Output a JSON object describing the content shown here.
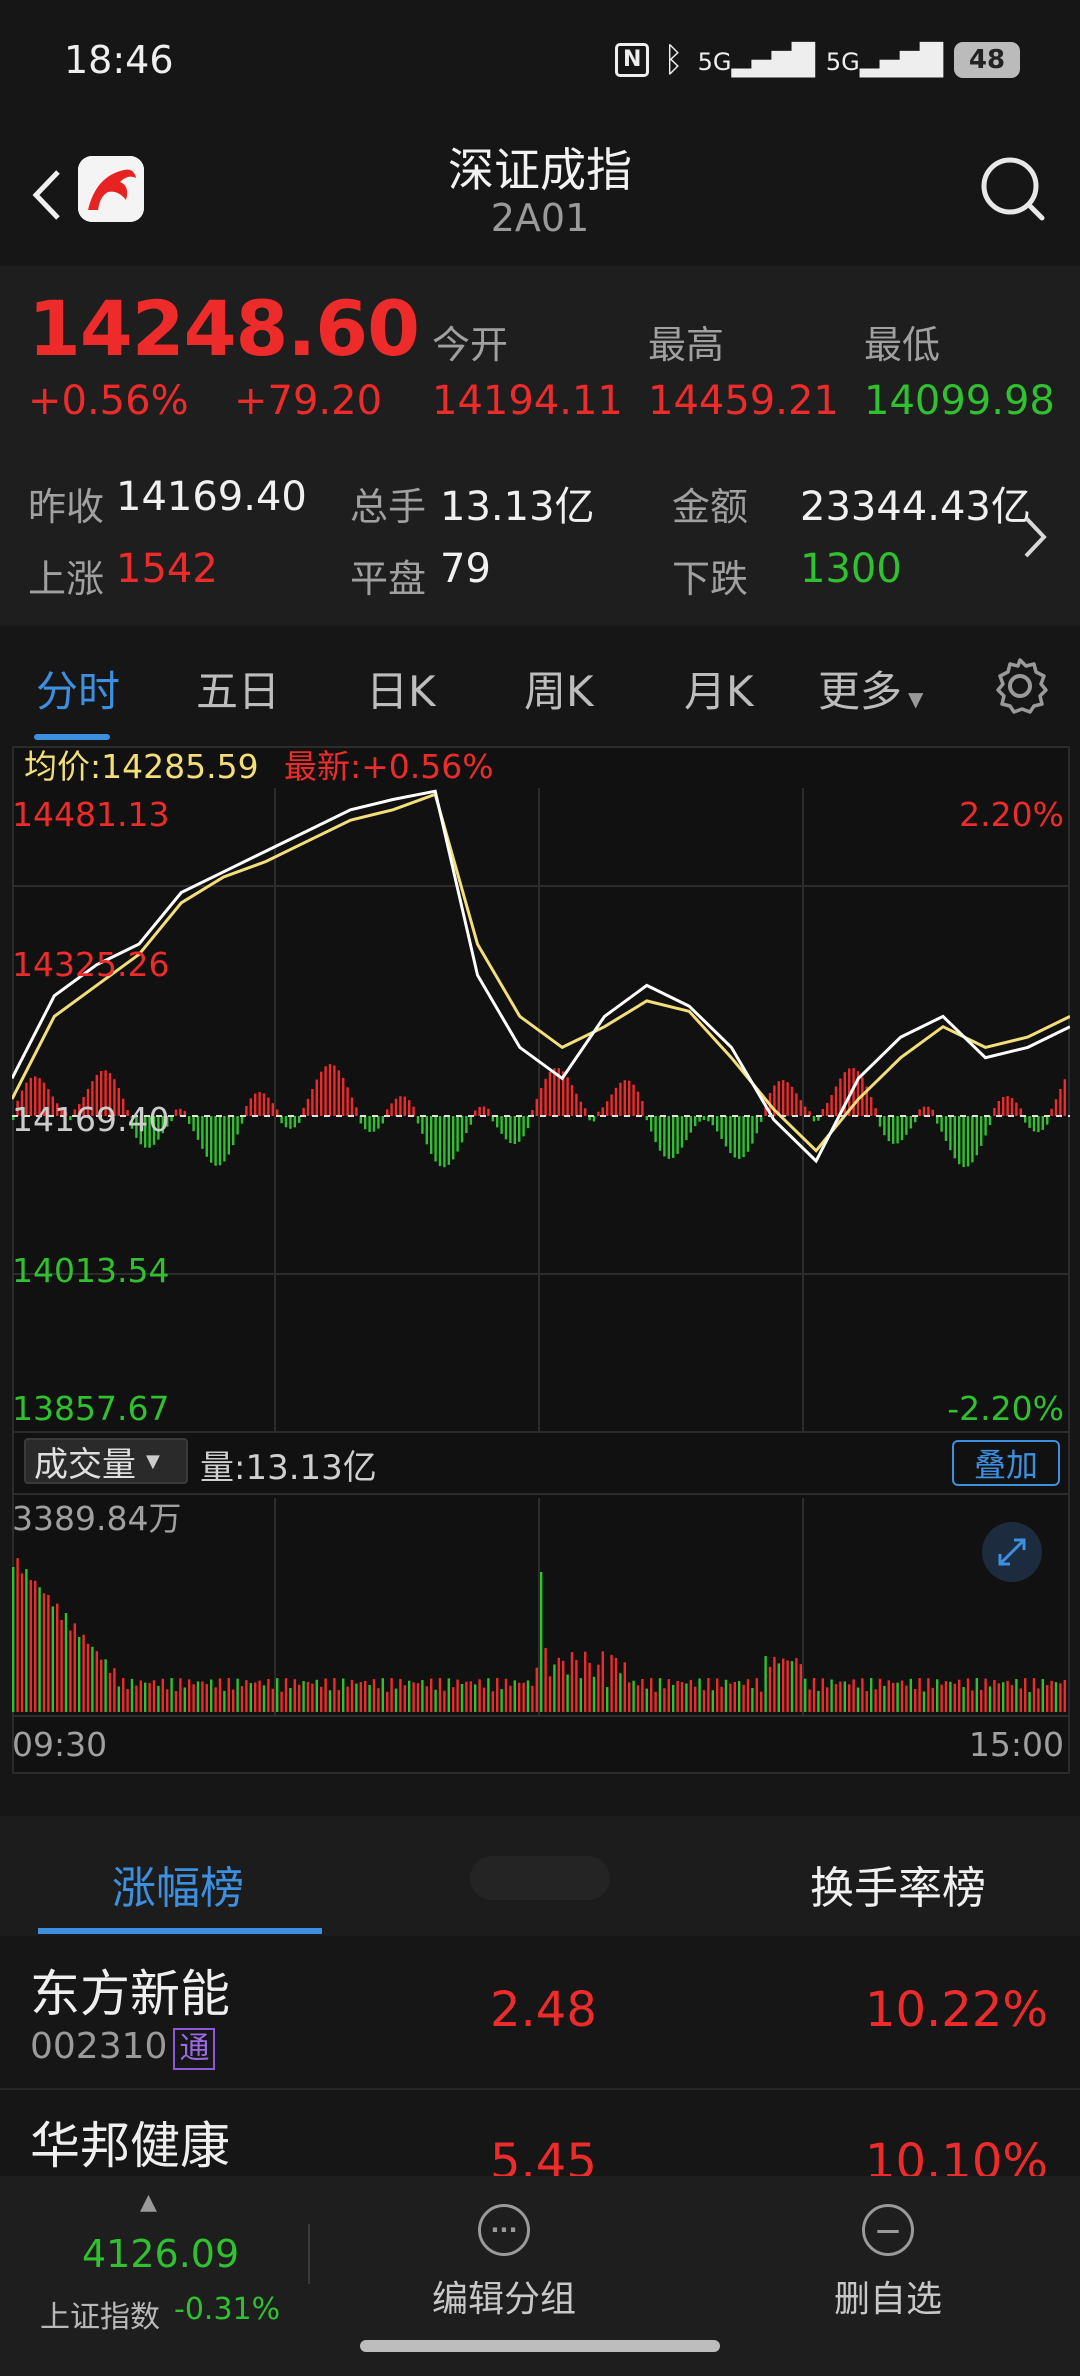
{
  "status_bar": {
    "time": "18:46",
    "battery": "48",
    "network1": "5G",
    "network2": "5G"
  },
  "header": {
    "title": "深证成指",
    "subtitle": "2A01"
  },
  "quote": {
    "price": "14248.60",
    "change_pct": "+0.56%",
    "change_abs": "+79.20",
    "open_label": "今开",
    "open": "14194.11",
    "high_label": "最高",
    "high": "14459.21",
    "low_label": "最低",
    "low": "14099.98",
    "prev_close_label": "昨收",
    "prev_close": "14169.40",
    "volume_label": "总手",
    "volume": "13.13亿",
    "amount_label": "金额",
    "amount": "23344.43亿",
    "up_label": "上涨",
    "up": "1542",
    "flat_label": "平盘",
    "flat": "79",
    "down_label": "下跌",
    "down": "1300"
  },
  "tabs": [
    "分时",
    "五日",
    "日K",
    "周K",
    "月K",
    "更多"
  ],
  "chart": {
    "avg_label": "均价:14285.59",
    "latest_label": "最新:+0.56%",
    "y_labels": [
      "14481.13",
      "14325.26",
      "14169.40",
      "14013.54",
      "13857.67"
    ],
    "pct_top": "2.20%",
    "pct_bottom": "-2.20%",
    "volume_select": "成交量",
    "volume_text": "量:13.13亿",
    "overlay_label": "叠加",
    "volume_max": "3389.84万",
    "time_start": "09:30",
    "time_end": "15:00",
    "colors": {
      "up": "#ee2b2b",
      "down": "#2fc12f",
      "price_line": "#ffffff",
      "avg_line": "#f3de7a",
      "accent": "#3d8fe0"
    }
  },
  "chart_data": {
    "type": "line",
    "x": [
      "09:30",
      "15:00"
    ],
    "series": [
      {
        "values": [
          14200,
          14280,
          14310,
          14330,
          14380,
          14400,
          14420,
          14440,
          14460,
          14470,
          14478,
          14300,
          14230,
          14200,
          14260,
          14290,
          14270,
          14230,
          14160,
          14120,
          14200,
          14240,
          14260,
          14220,
          14230,
          14250
        ]
      },
      {
        "values": [
          14180,
          14260,
          14290,
          14320,
          14370,
          14395,
          14410,
          14430,
          14450,
          14460,
          14475,
          14330,
          14260,
          14230,
          14250,
          14275,
          14265,
          14220,
          14170,
          14130,
          14180,
          14220,
          14250,
          14230,
          14240,
          14260
        ]
      }
    ],
    "ylim": [
      13857.67,
      14481.13
    ]
  },
  "ranking": {
    "tabs": [
      "涨幅榜",
      "换手率榜"
    ],
    "rows": [
      {
        "name": "东方新能",
        "code": "002310",
        "badge": "通",
        "price": "2.48",
        "pct": "10.22%"
      },
      {
        "name": "华邦健康",
        "code": "",
        "badge": "",
        "price": "5.45",
        "pct": "10.10%"
      }
    ]
  },
  "bottom_bar": {
    "index_value": "4126.09",
    "index_name": "上证指数",
    "index_pct": "-0.31%",
    "edit_group": "编辑分组",
    "remove_watch": "删自选"
  }
}
